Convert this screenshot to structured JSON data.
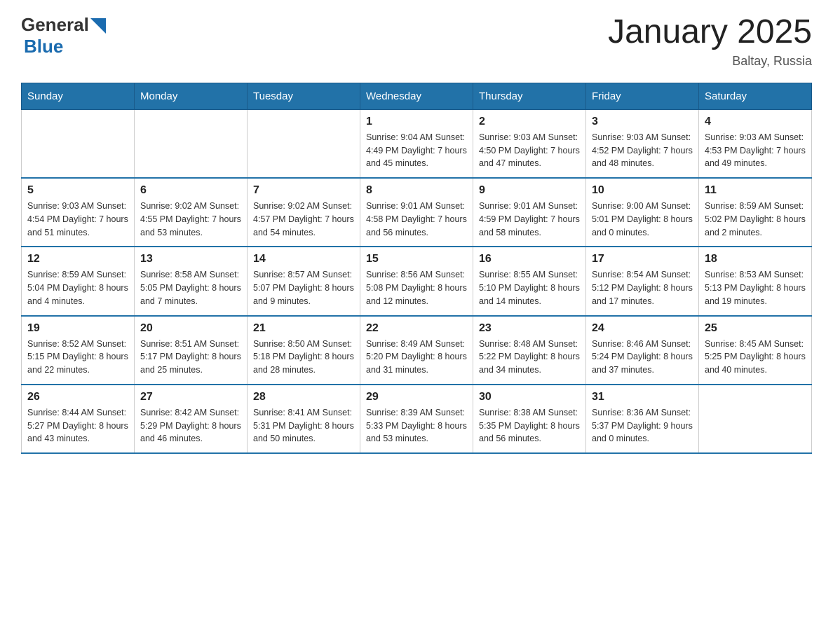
{
  "header": {
    "logo_general": "General",
    "logo_blue": "Blue",
    "title": "January 2025",
    "location": "Baltay, Russia"
  },
  "days_of_week": [
    "Sunday",
    "Monday",
    "Tuesday",
    "Wednesday",
    "Thursday",
    "Friday",
    "Saturday"
  ],
  "weeks": [
    [
      {
        "day": "",
        "info": ""
      },
      {
        "day": "",
        "info": ""
      },
      {
        "day": "",
        "info": ""
      },
      {
        "day": "1",
        "info": "Sunrise: 9:04 AM\nSunset: 4:49 PM\nDaylight: 7 hours\nand 45 minutes."
      },
      {
        "day": "2",
        "info": "Sunrise: 9:03 AM\nSunset: 4:50 PM\nDaylight: 7 hours\nand 47 minutes."
      },
      {
        "day": "3",
        "info": "Sunrise: 9:03 AM\nSunset: 4:52 PM\nDaylight: 7 hours\nand 48 minutes."
      },
      {
        "day": "4",
        "info": "Sunrise: 9:03 AM\nSunset: 4:53 PM\nDaylight: 7 hours\nand 49 minutes."
      }
    ],
    [
      {
        "day": "5",
        "info": "Sunrise: 9:03 AM\nSunset: 4:54 PM\nDaylight: 7 hours\nand 51 minutes."
      },
      {
        "day": "6",
        "info": "Sunrise: 9:02 AM\nSunset: 4:55 PM\nDaylight: 7 hours\nand 53 minutes."
      },
      {
        "day": "7",
        "info": "Sunrise: 9:02 AM\nSunset: 4:57 PM\nDaylight: 7 hours\nand 54 minutes."
      },
      {
        "day": "8",
        "info": "Sunrise: 9:01 AM\nSunset: 4:58 PM\nDaylight: 7 hours\nand 56 minutes."
      },
      {
        "day": "9",
        "info": "Sunrise: 9:01 AM\nSunset: 4:59 PM\nDaylight: 7 hours\nand 58 minutes."
      },
      {
        "day": "10",
        "info": "Sunrise: 9:00 AM\nSunset: 5:01 PM\nDaylight: 8 hours\nand 0 minutes."
      },
      {
        "day": "11",
        "info": "Sunrise: 8:59 AM\nSunset: 5:02 PM\nDaylight: 8 hours\nand 2 minutes."
      }
    ],
    [
      {
        "day": "12",
        "info": "Sunrise: 8:59 AM\nSunset: 5:04 PM\nDaylight: 8 hours\nand 4 minutes."
      },
      {
        "day": "13",
        "info": "Sunrise: 8:58 AM\nSunset: 5:05 PM\nDaylight: 8 hours\nand 7 minutes."
      },
      {
        "day": "14",
        "info": "Sunrise: 8:57 AM\nSunset: 5:07 PM\nDaylight: 8 hours\nand 9 minutes."
      },
      {
        "day": "15",
        "info": "Sunrise: 8:56 AM\nSunset: 5:08 PM\nDaylight: 8 hours\nand 12 minutes."
      },
      {
        "day": "16",
        "info": "Sunrise: 8:55 AM\nSunset: 5:10 PM\nDaylight: 8 hours\nand 14 minutes."
      },
      {
        "day": "17",
        "info": "Sunrise: 8:54 AM\nSunset: 5:12 PM\nDaylight: 8 hours\nand 17 minutes."
      },
      {
        "day": "18",
        "info": "Sunrise: 8:53 AM\nSunset: 5:13 PM\nDaylight: 8 hours\nand 19 minutes."
      }
    ],
    [
      {
        "day": "19",
        "info": "Sunrise: 8:52 AM\nSunset: 5:15 PM\nDaylight: 8 hours\nand 22 minutes."
      },
      {
        "day": "20",
        "info": "Sunrise: 8:51 AM\nSunset: 5:17 PM\nDaylight: 8 hours\nand 25 minutes."
      },
      {
        "day": "21",
        "info": "Sunrise: 8:50 AM\nSunset: 5:18 PM\nDaylight: 8 hours\nand 28 minutes."
      },
      {
        "day": "22",
        "info": "Sunrise: 8:49 AM\nSunset: 5:20 PM\nDaylight: 8 hours\nand 31 minutes."
      },
      {
        "day": "23",
        "info": "Sunrise: 8:48 AM\nSunset: 5:22 PM\nDaylight: 8 hours\nand 34 minutes."
      },
      {
        "day": "24",
        "info": "Sunrise: 8:46 AM\nSunset: 5:24 PM\nDaylight: 8 hours\nand 37 minutes."
      },
      {
        "day": "25",
        "info": "Sunrise: 8:45 AM\nSunset: 5:25 PM\nDaylight: 8 hours\nand 40 minutes."
      }
    ],
    [
      {
        "day": "26",
        "info": "Sunrise: 8:44 AM\nSunset: 5:27 PM\nDaylight: 8 hours\nand 43 minutes."
      },
      {
        "day": "27",
        "info": "Sunrise: 8:42 AM\nSunset: 5:29 PM\nDaylight: 8 hours\nand 46 minutes."
      },
      {
        "day": "28",
        "info": "Sunrise: 8:41 AM\nSunset: 5:31 PM\nDaylight: 8 hours\nand 50 minutes."
      },
      {
        "day": "29",
        "info": "Sunrise: 8:39 AM\nSunset: 5:33 PM\nDaylight: 8 hours\nand 53 minutes."
      },
      {
        "day": "30",
        "info": "Sunrise: 8:38 AM\nSunset: 5:35 PM\nDaylight: 8 hours\nand 56 minutes."
      },
      {
        "day": "31",
        "info": "Sunrise: 8:36 AM\nSunset: 5:37 PM\nDaylight: 9 hours\nand 0 minutes."
      },
      {
        "day": "",
        "info": ""
      }
    ]
  ]
}
